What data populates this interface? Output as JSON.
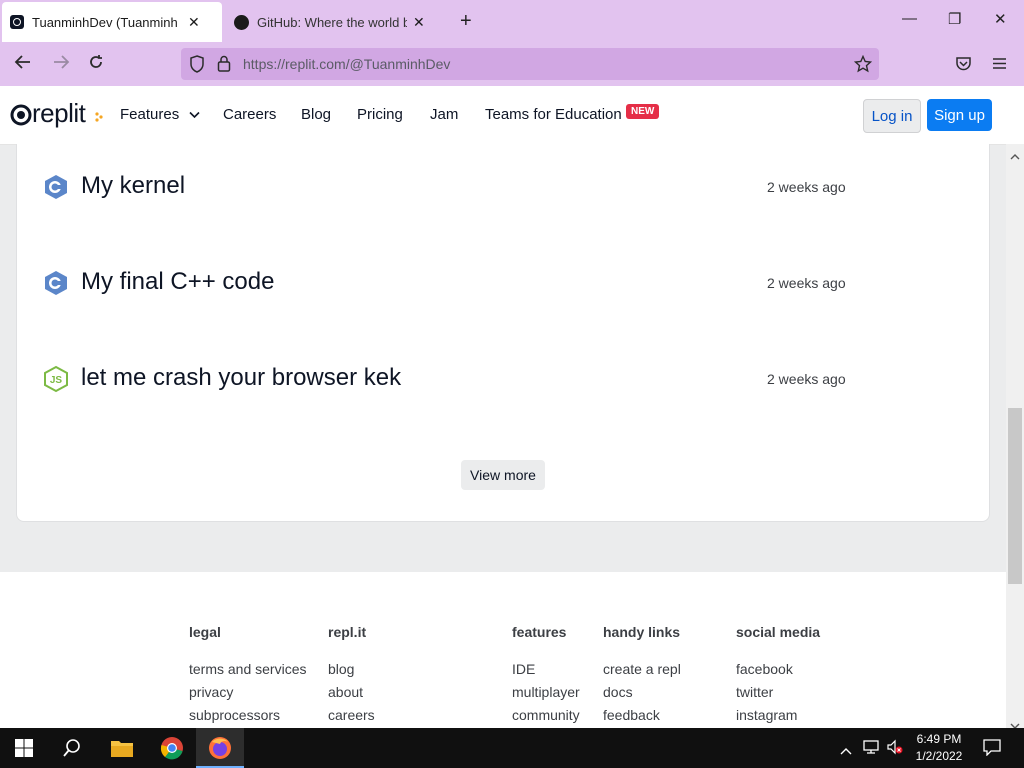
{
  "browser": {
    "tabs": [
      {
        "title": "TuanminhDev (Tuanminh Programming)",
        "active": true
      },
      {
        "title": "GitHub: Where the world builds software",
        "active": false
      }
    ],
    "new_tab_symbol": "+",
    "close_symbol": "✕",
    "url": "https://replit.com/@TuanminhDev",
    "window_controls": {
      "minimize": "—",
      "maximize": "❐",
      "close": "✕"
    }
  },
  "header": {
    "logo_text": "replit",
    "nav": {
      "features": "Features",
      "careers": "Careers",
      "blog": "Blog",
      "pricing": "Pricing",
      "jam": "Jam",
      "teams": "Teams for Education",
      "new_badge": "NEW"
    },
    "login": "Log in",
    "signup": "Sign up"
  },
  "repls": [
    {
      "title": "My kernel",
      "time": "2 weeks ago",
      "lang": "cpp",
      "icon": "cpp-icon"
    },
    {
      "title": "My final C++ code",
      "time": "2 weeks ago",
      "lang": "cpp",
      "icon": "cpp-icon"
    },
    {
      "title": "let me crash your browser kek",
      "time": "2 weeks ago",
      "lang": "nodejs",
      "icon": "nodejs-icon"
    }
  ],
  "view_more": "View more",
  "footer": {
    "legal": {
      "heading": "legal",
      "links": [
        "terms and services",
        "privacy",
        "subprocessors"
      ]
    },
    "replit": {
      "heading": "repl.it",
      "links": [
        "blog",
        "about",
        "careers"
      ]
    },
    "features": {
      "heading": "features",
      "links": [
        "IDE",
        "multiplayer",
        "community"
      ]
    },
    "handy": {
      "heading": "handy links",
      "links": [
        "create a repl",
        "docs",
        "feedback"
      ]
    },
    "social": {
      "heading": "social media",
      "links": [
        "facebook",
        "twitter",
        "instagram"
      ]
    }
  },
  "taskbar": {
    "time": "6:49 PM",
    "date": "1/2/2022"
  },
  "colors": {
    "browser_chrome": "#e2c3ef",
    "signup_blue": "#0b7cf2",
    "new_badge": "#e52e47",
    "cpp_blue": "#5b86c9",
    "node_green": "#7cba44"
  }
}
